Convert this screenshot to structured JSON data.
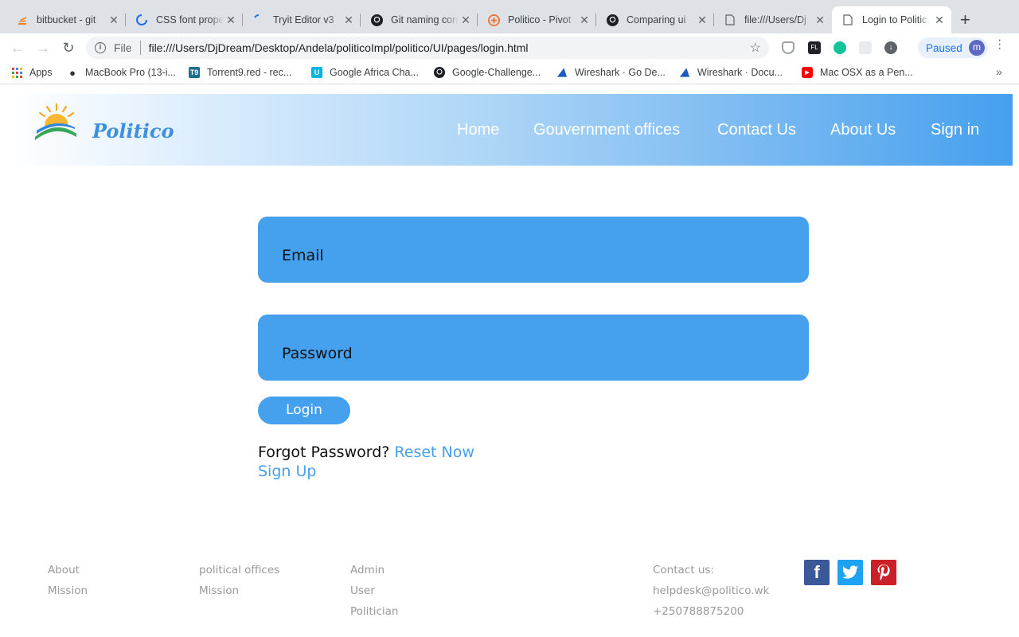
{
  "browser": {
    "tabs": [
      {
        "title": "bitbucket - git",
        "icon": "stackoverflow-icon"
      },
      {
        "title": "CSS font prope",
        "icon": "loading-icon"
      },
      {
        "title": "Tryit Editor v3",
        "icon": "loading-icon"
      },
      {
        "title": "Git naming con",
        "icon": "github-icon"
      },
      {
        "title": "Politico - Pivot",
        "icon": "pivotal-icon"
      },
      {
        "title": "Comparing ui",
        "icon": "github-icon"
      },
      {
        "title": "file:///Users/Dj",
        "icon": "file-icon"
      },
      {
        "title": "Login to Politic",
        "icon": "file-icon"
      }
    ],
    "address": {
      "scheme": "File",
      "url": "file:///Users/DjDream/Desktop/Andela/politicoImpl/politico/UI/pages/login.html"
    },
    "profile": {
      "status": "Paused",
      "initial": "m"
    },
    "bookmarks": [
      {
        "label": "Apps",
        "icon": "apps-grid-icon"
      },
      {
        "label": "MacBook Pro (13-i...",
        "icon": "apple-icon"
      },
      {
        "label": "Torrent9.red - rec...",
        "icon": "torrent9-icon"
      },
      {
        "label": "Google Africa Cha...",
        "icon": "udacity-icon"
      },
      {
        "label": "Google-Challenge...",
        "icon": "github-icon"
      },
      {
        "label": "Wireshark · Go De...",
        "icon": "wireshark-icon"
      },
      {
        "label": "Wireshark · Docu...",
        "icon": "wireshark-icon"
      },
      {
        "label": "Mac OSX as a Pen...",
        "icon": "youtube-icon"
      }
    ]
  },
  "site": {
    "brand": "Politico",
    "nav": [
      "Home",
      "Gouvernment offices",
      "Contact Us",
      "About Us",
      "Sign in"
    ]
  },
  "login": {
    "email_placeholder": "Email",
    "password_placeholder": "Password",
    "button": "Login",
    "forgot_text": "Forgot Password?",
    "reset_link": "Reset Now",
    "signup_link": "Sign Up"
  },
  "footer": {
    "col1": [
      "About",
      "Mission"
    ],
    "col2": [
      "political offices",
      "Mission"
    ],
    "col3": [
      "Admin",
      "User",
      "Politician"
    ],
    "contact": [
      "Contact us:",
      "helpdesk@politico.wk",
      "+250788875200"
    ],
    "social": [
      "facebook-icon",
      "twitter-icon",
      "pinterest-icon"
    ]
  },
  "colors": {
    "accent": "#45a0ee",
    "footer_text": "#999999",
    "facebook": "#3b5998",
    "twitter": "#1da1f2",
    "pinterest": "#cb2027"
  }
}
